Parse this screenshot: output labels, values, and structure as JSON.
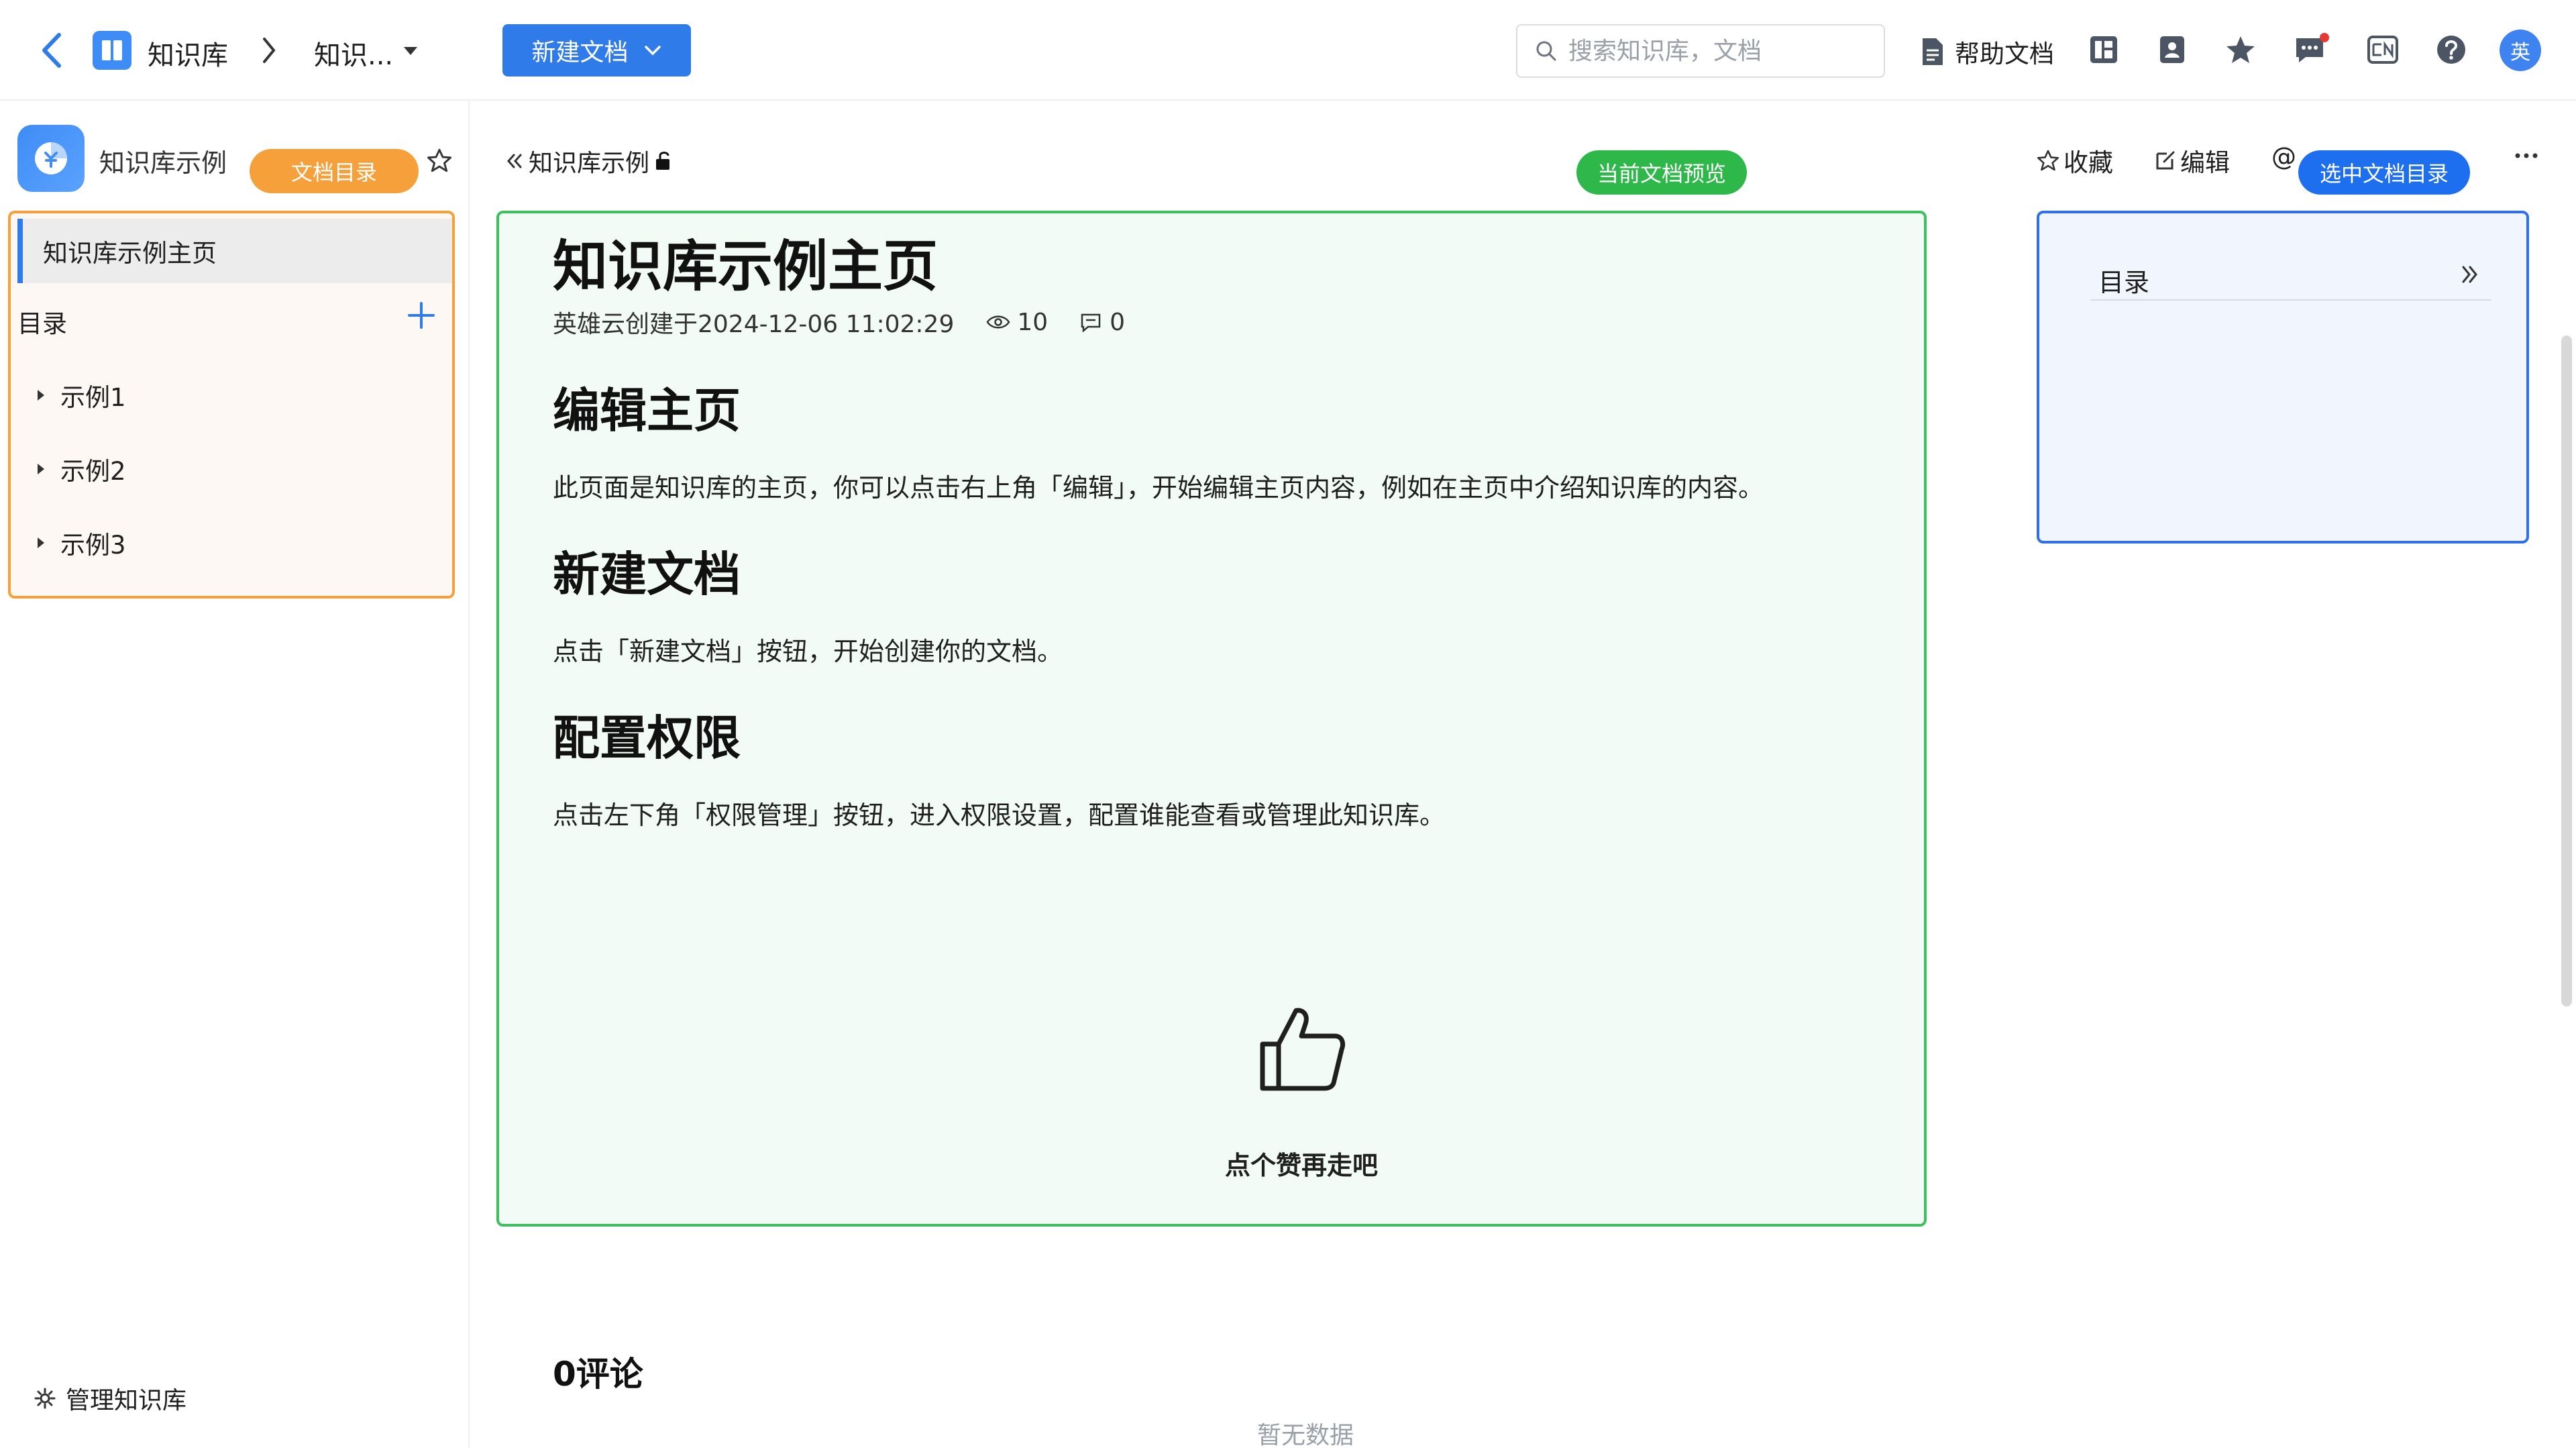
{
  "topbar": {
    "app_name": "知识库",
    "crumb_current": "知识...",
    "new_doc_label": "新建文档",
    "search_placeholder": "搜索知识库，文档",
    "help_label": "帮助文档",
    "avatar_text": "英",
    "icons": [
      "back-arrow-icon",
      "kb-app-icon",
      "chevron-right-icon",
      "caret-down-icon",
      "search-icon",
      "doc-icon",
      "layout-icon",
      "contacts-icon",
      "star-icon",
      "message-icon",
      "language-icon",
      "help-icon"
    ]
  },
  "sidebar": {
    "kb_name": "知识库示例",
    "overlay_tag": "文档目录",
    "home_item": "知识库示例主页",
    "toc_title": "目录",
    "items": [
      {
        "label": "示例1"
      },
      {
        "label": "示例2"
      },
      {
        "label": "示例3"
      }
    ],
    "manage_label": "管理知识库"
  },
  "main": {
    "breadcrumb": "知识库示例",
    "overlay_tag": "当前文档预览",
    "actions": {
      "favorite": "收藏",
      "edit": "编辑",
      "at": "@"
    },
    "toc_overlay_tag": "选中文档目录",
    "doc": {
      "title": "知识库示例主页",
      "meta_author": "英雄云创建于2024-12-06 11:02:29",
      "views": "10",
      "comments_count": "0",
      "sections": [
        {
          "heading": "编辑主页",
          "text": "此页面是知识库的主页，你可以点击右上角「编辑」，开始编辑主页内容，例如在主页中介绍知识库的内容。"
        },
        {
          "heading": "新建文档",
          "text": "点击「新建文档」按钮，开始创建你的文档。"
        },
        {
          "heading": "配置权限",
          "text": "点击左下角「权限管理」按钮，进入权限设置，配置谁能查看或管理此知识库。"
        }
      ],
      "like_text": "点个赞再走吧"
    },
    "comments_title": "0评论",
    "no_data": "暂无数据"
  },
  "toc_panel": {
    "title": "目录"
  },
  "colors": {
    "primary": "#2f7bea",
    "orange": "#f5a03a",
    "green": "#2fb84a",
    "blue_tag": "#1e6ff0"
  }
}
